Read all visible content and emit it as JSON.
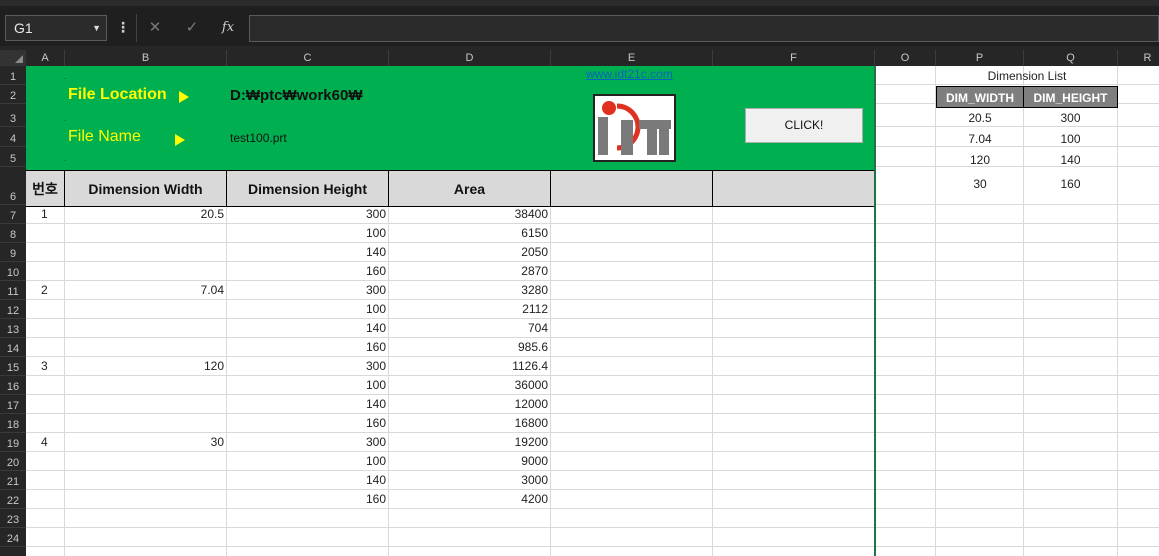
{
  "formula_bar": {
    "name_box": "G1",
    "more_icon": "⋮",
    "cancel_icon": "✕",
    "enter_icon": "✓",
    "fx_label": "fx",
    "formula": ""
  },
  "columns": [
    "A",
    "B",
    "C",
    "D",
    "E",
    "F",
    "O",
    "P",
    "Q",
    "R"
  ],
  "rows": [
    "1",
    "2",
    "3",
    "4",
    "5",
    "6",
    "7",
    "8",
    "9",
    "10",
    "11",
    "12",
    "13",
    "14",
    "15",
    "16",
    "17",
    "18",
    "19",
    "20",
    "21",
    "22",
    "23",
    "24"
  ],
  "header_block": {
    "dot": ".",
    "file_location_label": "File Location",
    "file_location_value": "D:₩ptc₩work60₩",
    "file_name_label": "File Name",
    "file_name_value": "test100.prt",
    "website": "www.idt21c.com",
    "click_button": "CLICK!",
    "accent_color": "#00b050",
    "label_color": "#ffff00"
  },
  "table": {
    "headers": [
      "번호",
      "Dimension Width",
      "Dimension Height",
      "Area",
      "",
      ""
    ],
    "rows": [
      {
        "no": "1",
        "width": "20.5",
        "height": "300",
        "area": "38400"
      },
      {
        "no": "",
        "width": "",
        "height": "100",
        "area": "6150"
      },
      {
        "no": "",
        "width": "",
        "height": "140",
        "area": "2050"
      },
      {
        "no": "",
        "width": "",
        "height": "160",
        "area": "2870"
      },
      {
        "no": "2",
        "width": "7.04",
        "height": "300",
        "area": "3280"
      },
      {
        "no": "",
        "width": "",
        "height": "100",
        "area": "2112"
      },
      {
        "no": "",
        "width": "",
        "height": "140",
        "area": "704"
      },
      {
        "no": "",
        "width": "",
        "height": "160",
        "area": "985.6"
      },
      {
        "no": "3",
        "width": "120",
        "height": "300",
        "area": "1126.4"
      },
      {
        "no": "",
        "width": "",
        "height": "100",
        "area": "36000"
      },
      {
        "no": "",
        "width": "",
        "height": "140",
        "area": "12000"
      },
      {
        "no": "",
        "width": "",
        "height": "160",
        "area": "16800"
      },
      {
        "no": "4",
        "width": "30",
        "height": "300",
        "area": "19200"
      },
      {
        "no": "",
        "width": "",
        "height": "100",
        "area": "9000"
      },
      {
        "no": "",
        "width": "",
        "height": "140",
        "area": "3000"
      },
      {
        "no": "",
        "width": "",
        "height": "160",
        "area": "4200"
      }
    ]
  },
  "dimension_list": {
    "title": "Dimension List",
    "headers": [
      "DIM_WIDTH",
      "DIM_HEIGHT"
    ],
    "rows": [
      [
        "20.5",
        "300"
      ],
      [
        "7.04",
        "100"
      ],
      [
        "120",
        "140"
      ],
      [
        "30",
        "160"
      ]
    ]
  }
}
